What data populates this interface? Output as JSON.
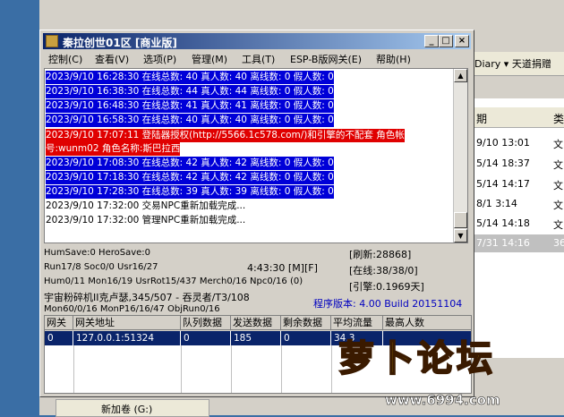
{
  "background_window": {
    "toolbar_text": "Diary ▾ 天道捐赠",
    "list_headers": [
      "期",
      "类"
    ],
    "rows": [
      {
        "date": "9/10 13:01",
        "type": "文"
      },
      {
        "date": "5/14 18:37",
        "type": "文"
      },
      {
        "date": "5/14 14:17",
        "type": "文"
      },
      {
        "date": "8/1 3:14",
        "type": "文"
      },
      {
        "date": "5/14 14:18",
        "type": "文"
      },
      {
        "date": "7/31 14:16",
        "type": "36"
      }
    ],
    "drive_label": "新加卷 (G:)"
  },
  "window": {
    "title": "秦拉创世01区 [商业版]",
    "buttons": {
      "minimize": "_",
      "maximize": "□",
      "close": "×"
    }
  },
  "menu": [
    "控制(C)",
    "查看(V)",
    "选项(P)",
    "管理(M)",
    "工具(T)",
    "ESP-B版网关(E)",
    "帮助(H)"
  ],
  "log": [
    {
      "style": "blue",
      "text": "2023/9/10 16:28:30 在线总数: 40 真人数: 40 离线数: 0 假人数: 0"
    },
    {
      "style": "blue",
      "text": "2023/9/10 16:38:30 在线总数: 44 真人数: 44 离线数: 0 假人数: 0"
    },
    {
      "style": "blue",
      "text": "2023/9/10 16:48:30 在线总数: 41 真人数: 41 离线数: 0 假人数: 0"
    },
    {
      "style": "blue",
      "text": "2023/9/10 16:58:30 在线总数: 40 真人数: 40 离线数: 0 假人数: 0"
    },
    {
      "style": "red",
      "text": "2023/9/10 17:07:11 登陆器授权(http://5566.1c578.com/)和引擎的不配套 角色帐"
    },
    {
      "style": "red",
      "text": "号:wunm02 角色名称:斯巴拉西"
    },
    {
      "style": "blue",
      "text": "2023/9/10 17:08:30 在线总数: 42 真人数: 42 离线数: 0 假人数: 0"
    },
    {
      "style": "blue",
      "text": "2023/9/10 17:18:30 在线总数: 42 真人数: 42 离线数: 0 假人数: 0"
    },
    {
      "style": "blue",
      "text": "2023/9/10 17:28:30 在线总数: 39 真人数: 39 离线数: 0 假人数: 0"
    },
    {
      "style": "plain",
      "text": "2023/9/10 17:32:00 交易NPC重新加载完成..."
    },
    {
      "style": "plain",
      "text": "2023/9/10 17:32:00 管理NPC重新加载完成..."
    }
  ],
  "status": {
    "line1": "HumSave:0 HeroSave:0",
    "line2": "Run17/8 Soc0/0 Usr16/27",
    "time": "4:43:30 [M][F]",
    "line3": "Hum0/11 Mon16/19 UsrRot15/437 Merch0/16 Npc0/16 (0)",
    "line4": "宇宙粉碎机II克卢瑟,345/507 - 吞灵者/T3/108",
    "line5": "Mon60/0/16 MonP16/16/47 ObjRun0/16",
    "refresh": "[刷新:28868]",
    "online": "[在线:38/38/0]",
    "engine": "[引擎:0.1969天]",
    "version": "程序版本: 4.00 Build 20151104"
  },
  "grid": {
    "headers": [
      "网关",
      "网关地址",
      "队列数据",
      "发送数据",
      "剩余数据",
      "平均流量",
      "最高人数"
    ],
    "row": [
      "0",
      "127.0.0.1:51324",
      "0",
      "185",
      "0",
      "34.3",
      ""
    ]
  },
  "watermark": {
    "text": "萝卜论坛",
    "url": "www.6994.com"
  }
}
